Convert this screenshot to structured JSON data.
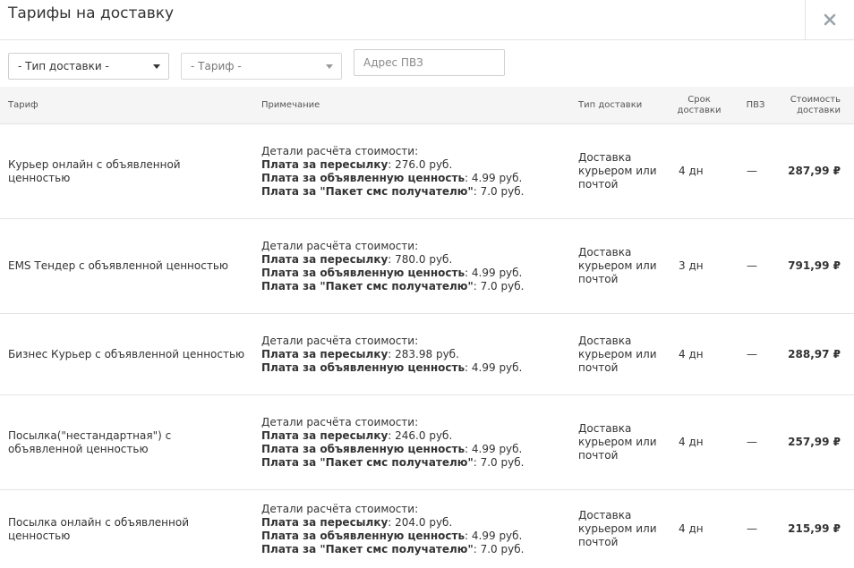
{
  "header": {
    "title": "Тарифы на доставку",
    "close_icon": "close-icon"
  },
  "filters": {
    "delivery_type": "- Тип доставки -",
    "tariff": "- Тариф -",
    "pvz_placeholder": "Адрес ПВЗ"
  },
  "table": {
    "headers": {
      "tariff": "Тариф",
      "note": "Примечание",
      "delivery_type": "Тип доставки",
      "term": "Срок доставки",
      "pvz": "ПВЗ",
      "price": "Стоимость доставки"
    },
    "rows": [
      {
        "tariff": "Курьер онлайн с объявленной ценностью",
        "note_title": "Детали расчёта стоимости:",
        "note_items": [
          {
            "label": "Плата за пересылку",
            "value": ": 276.0 руб."
          },
          {
            "label": "Плата за объявленную ценность",
            "value": ": 4.99 руб."
          },
          {
            "label": "Плата за \"Пакет смс получателю\"",
            "value": ": 7.0 руб."
          }
        ],
        "delivery_type": "Доставка курьером или почтой",
        "term": "4 дн",
        "pvz": "—",
        "price": "287,99 ₽"
      },
      {
        "tariff": "EMS Тендер с объявленной ценностью",
        "note_title": "Детали расчёта стоимости:",
        "note_items": [
          {
            "label": "Плата за пересылку",
            "value": ": 780.0 руб."
          },
          {
            "label": "Плата за объявленную ценность",
            "value": ": 4.99 руб."
          },
          {
            "label": "Плата за \"Пакет смс получателю\"",
            "value": ": 7.0 руб."
          }
        ],
        "delivery_type": "Доставка курьером или почтой",
        "term": "3 дн",
        "pvz": "—",
        "price": "791,99 ₽"
      },
      {
        "tariff": "Бизнес Курьер с объявленной ценностью",
        "note_title": "Детали расчёта стоимости:",
        "note_items": [
          {
            "label": "Плата за пересылку",
            "value": ": 283.98 руб."
          },
          {
            "label": "Плата за объявленную ценность",
            "value": ": 4.99 руб."
          }
        ],
        "delivery_type": "Доставка курьером или почтой",
        "term": "4 дн",
        "pvz": "—",
        "price": "288,97 ₽"
      },
      {
        "tariff": "Посылка(\"нестандартная\") с объявленной ценностью",
        "note_title": "Детали расчёта стоимости:",
        "note_items": [
          {
            "label": "Плата за пересылку",
            "value": ": 246.0 руб."
          },
          {
            "label": "Плата за объявленную ценность",
            "value": ": 4.99 руб."
          },
          {
            "label": "Плата за \"Пакет смс получателю\"",
            "value": ": 7.0 руб."
          }
        ],
        "delivery_type": "Доставка курьером или почтой",
        "term": "4 дн",
        "pvz": "—",
        "price": "257,99 ₽"
      },
      {
        "tariff": "Посылка онлайн с объявленной ценностью",
        "note_title": "Детали расчёта стоимости:",
        "note_items": [
          {
            "label": "Плата за пересылку",
            "value": ": 204.0 руб."
          },
          {
            "label": "Плата за объявленную ценность",
            "value": ": 4.99 руб."
          },
          {
            "label": "Плата за \"Пакет смс получателю\"",
            "value": ": 7.0 руб."
          }
        ],
        "delivery_type": "Доставка курьером или почтой",
        "term": "4 дн",
        "pvz": "—",
        "price": "215,99 ₽"
      }
    ]
  }
}
